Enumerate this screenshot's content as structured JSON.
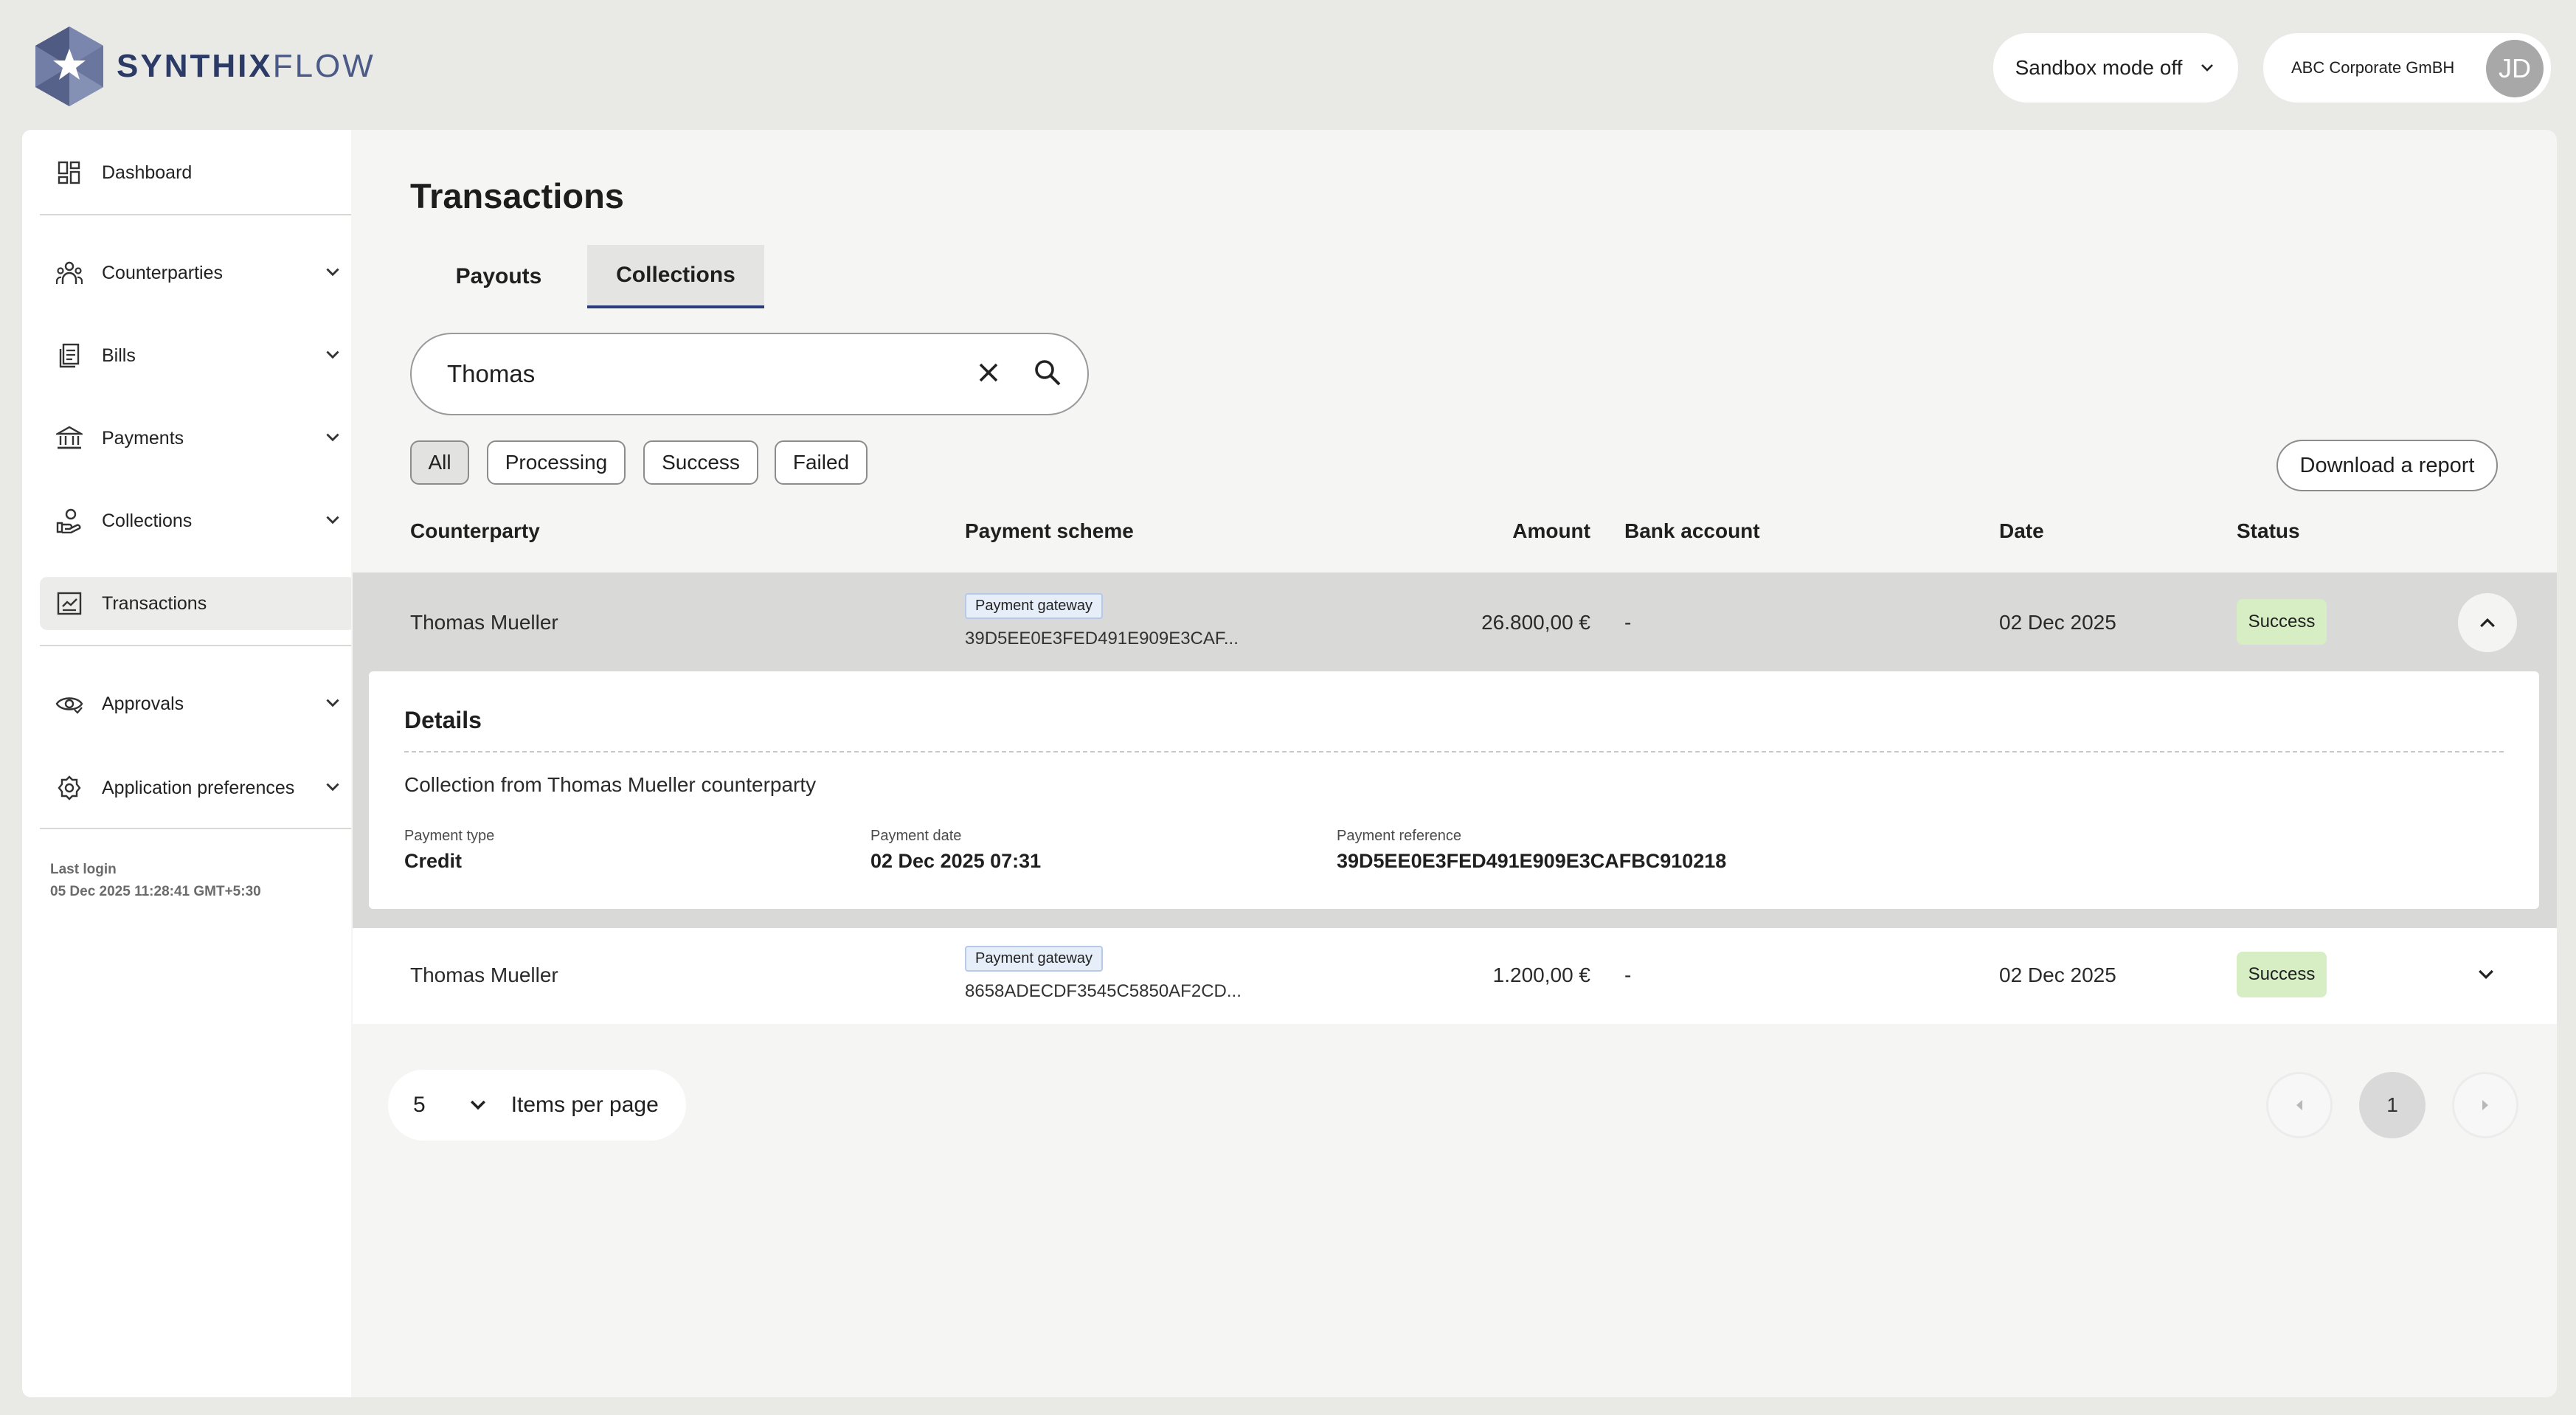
{
  "header": {
    "logo_text_bold": "SYNTHIX",
    "logo_text_light": "FLOW",
    "sandbox_label": "Sandbox mode off",
    "company": "ABC Corporate GmBH",
    "avatar_initials": "JD"
  },
  "sidebar": {
    "items": [
      {
        "label": "Dashboard",
        "icon": "dashboard-icon"
      },
      {
        "label": "Counterparties",
        "icon": "people-icon"
      },
      {
        "label": "Bills",
        "icon": "bills-icon"
      },
      {
        "label": "Payments",
        "icon": "bank-icon"
      },
      {
        "label": "Collections",
        "icon": "hand-coin-icon"
      },
      {
        "label": "Transactions",
        "icon": "transactions-icon"
      },
      {
        "label": "Approvals",
        "icon": "eye-icon"
      },
      {
        "label": "Application preferences",
        "icon": "gear-icon"
      }
    ],
    "active": "Transactions",
    "last_login_label": "Last login",
    "last_login_value": "05 Dec 2025 11:28:41 GMT+5:30"
  },
  "main": {
    "title": "Transactions",
    "tabs": [
      {
        "label": "Payouts"
      },
      {
        "label": "Collections"
      }
    ],
    "active_tab": "Collections",
    "search_value": "Thomas",
    "filters": [
      {
        "label": "All"
      },
      {
        "label": "Processing"
      },
      {
        "label": "Success"
      },
      {
        "label": "Failed"
      }
    ],
    "selected_filter": "All",
    "download_label": "Download a report",
    "columns": {
      "counterparty": "Counterparty",
      "scheme": "Payment scheme",
      "amount": "Amount",
      "bank": "Bank account",
      "date": "Date",
      "status": "Status"
    },
    "rows": [
      {
        "counterparty": "Thomas Mueller",
        "scheme_badge": "Payment gateway",
        "scheme_id": "39D5EE0E3FED491E909E3CAF...",
        "amount": "26.800,00 €",
        "bank": "-",
        "date": "02 Dec 2025",
        "status": "Success",
        "expanded": true,
        "details": {
          "title": "Details",
          "description": "Collection from Thomas Mueller counterparty",
          "type_label": "Payment type",
          "type_value": "Credit",
          "date_label": "Payment date",
          "date_value": "02 Dec 2025 07:31",
          "ref_label": "Payment reference",
          "ref_value": "39D5EE0E3FED491E909E3CAFBC910218"
        }
      },
      {
        "counterparty": "Thomas Mueller",
        "scheme_badge": "Payment gateway",
        "scheme_id": "8658ADECDF3545C5850AF2CD...",
        "amount": "1.200,00 €",
        "bank": "-",
        "date": "02 Dec 2025",
        "status": "Success",
        "expanded": false
      }
    ],
    "pagination": {
      "per_page": "5",
      "per_page_label": "Items per page",
      "current_page": "1"
    }
  },
  "colors": {
    "accent": "#2a3d7a",
    "success_bg": "#d7edc4",
    "page_bg": "#e9e9e6"
  }
}
